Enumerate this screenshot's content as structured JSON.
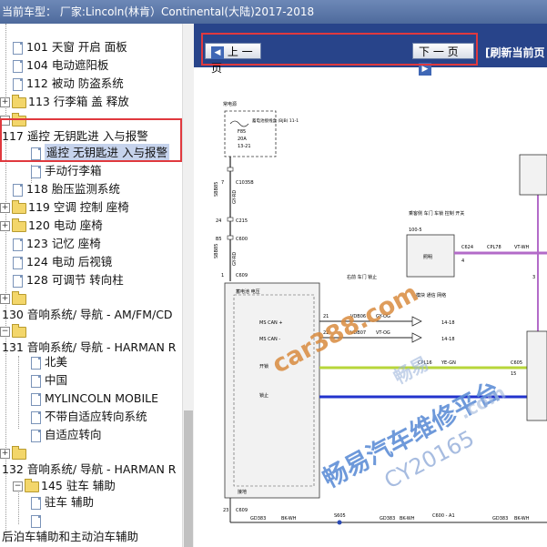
{
  "titlebar": {
    "text": "当前车型：  厂家:Lincoln(林肯）Continental(大陆)2017-2018"
  },
  "tree": [
    {
      "label": "101 天窗 开启 面板"
    },
    {
      "label": "104 电动遮阳板"
    },
    {
      "label": "112 被动 防盗系统"
    },
    {
      "label": "113 行李箱 盖 释放"
    },
    {
      "label": ""
    },
    {
      "label": "117 遥控 无钥匙进 入与报警"
    },
    {
      "label": "遥控 无钥匙进 入与报警"
    },
    {
      "label": "手动行李箱"
    },
    {
      "label": "118 胎压监测系统"
    },
    {
      "label": "119 空调 控制 座椅"
    },
    {
      "label": "120 电动 座椅"
    },
    {
      "label": "123 记忆 座椅"
    },
    {
      "label": "124 电动 后视镜"
    },
    {
      "label": "128 可调节 转向柱"
    },
    {
      "label": ""
    },
    {
      "label": "130 音响系统/ 导航 - AM/FM/CD"
    },
    {
      "label": ""
    },
    {
      "label": "131 音响系统/ 导航 - HARMAN R"
    },
    {
      "label": "北美"
    },
    {
      "label": "中国"
    },
    {
      "label": "MYLINCOLN MOBILE"
    },
    {
      "label": "不带自适应转向系统"
    },
    {
      "label": "自适应转向"
    },
    {
      "label": ""
    },
    {
      "label": "132 音响系统/ 导航 - HARMAN R"
    },
    {
      "label": "145 驻车 辅助"
    },
    {
      "label": "驻车 辅助"
    },
    {
      "label": ""
    },
    {
      "label": "后泊车辅助和主动泊车辅助"
    }
  ],
  "nav": {
    "prev_label": "上 一 页",
    "next_label": "下 一 页",
    "refresh_label": "[刷新当前页"
  },
  "diagram": {
    "fuse_title": "常电源",
    "fuse_box": "蓄电池接线盒 (BJB) 11-1",
    "fuse": "F85",
    "amp": "20A",
    "ref": "13-21",
    "c1035b": "C1035B",
    "w1_code": "SBB85",
    "w1_color": "GY-RD",
    "c215": "C215",
    "c600": "C600",
    "w2_code": "SBB85",
    "w2_color": "GY-RD",
    "c609": "C609",
    "pin7": "7",
    "pin24": "24",
    "pinB5": "B5",
    "pin1": "1",
    "module_power": "蓄电池 电压",
    "ms_can_h": "MS CAN +",
    "ms_can_l": "MS CAN -",
    "vdb06": "VDB06",
    "vdb07": "VDB07",
    "gy_og": "GY-OG",
    "vt_og": "VT-OG",
    "pin21": "21",
    "pin22": "22",
    "ref_1418": "14-18",
    "bus_label": "模块 通信 网络",
    "right_lock": "右前 车门 锁止",
    "unlock": "开锁",
    "lock": "锁止",
    "cpl16": "CPL16",
    "ye_gn": "YE-GN",
    "c605": "C605",
    "pin15": "15",
    "ground": "接地",
    "pin23": "23",
    "gd383": "GD383",
    "bk_wh": "BK-WH",
    "s605": "S605",
    "c600_a1": "C600 - A1",
    "sw_title": "乘客侧 车门 车锁 控制 开关",
    "sw_ref": "100-5",
    "lighting": "照明",
    "c624": "C624",
    "cpl78": "CPL78",
    "vt_wh": "VT-WH",
    "pin4": "4",
    "pin3": "3"
  },
  "watermarks": {
    "w1": "car388.com",
    "w2": "畅易汽车维修平台",
    "w3": "CY20165",
    "w4": "畅易",
    "w5": ".com"
  },
  "colors": {
    "titlebar": "#5872a6",
    "navbar": "#28448a",
    "highlight_box": "#e0393e",
    "wire_yellow_green": "#b7d63a",
    "wire_blue": "#2233cc",
    "wire_purple": "#b36bc8"
  }
}
